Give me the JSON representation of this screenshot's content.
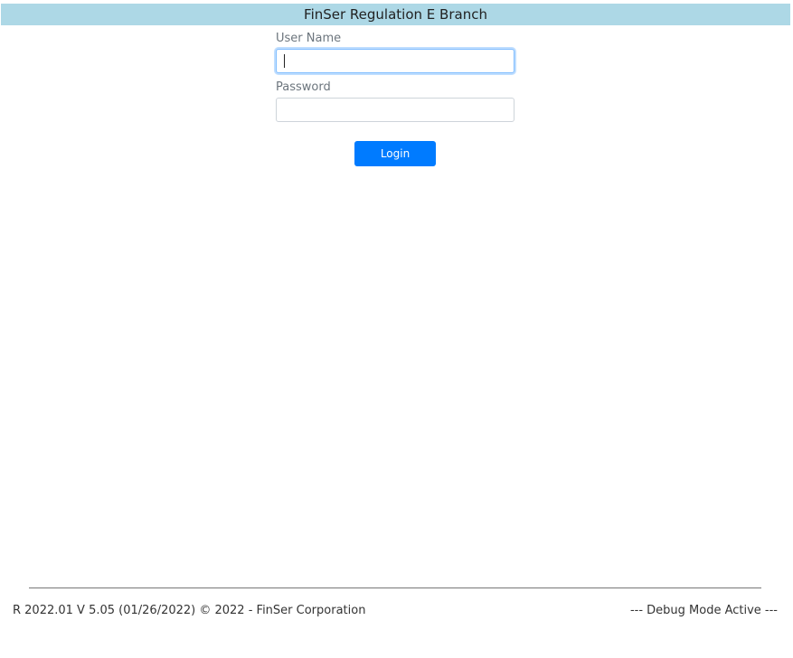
{
  "header": {
    "title": "FinSer Regulation E Branch"
  },
  "login_form": {
    "username_label": "User Name",
    "username_value": "",
    "password_label": "Password",
    "password_value": "",
    "login_button_label": "Login"
  },
  "footer": {
    "version_text": "R 2022.01 V 5.05 (01/26/2022) © 2022 - FinSer Corporation",
    "debug_text": "--- Debug Mode Active ---"
  },
  "colors": {
    "header_background": "#add8e6",
    "button_primary": "#007bff"
  }
}
